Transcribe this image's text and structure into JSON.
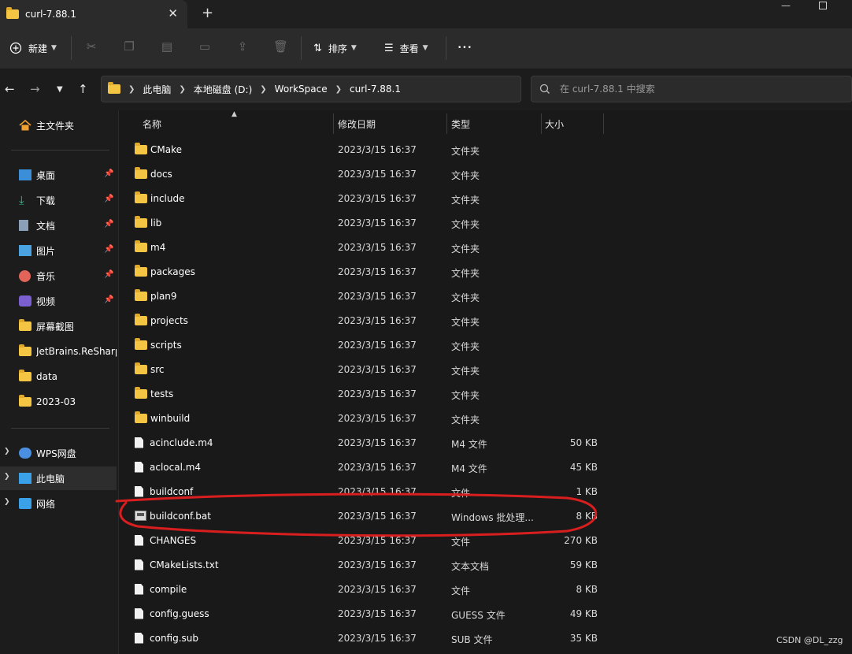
{
  "window": {
    "tab_title": "curl-7.88.1",
    "close_glyph": "✕",
    "new_tab_glyph": "+",
    "minimize_glyph": "—"
  },
  "toolbar": {
    "new_label": "新建",
    "sort_label": "排序",
    "view_label": "查看",
    "more_glyph": "•••"
  },
  "breadcrumb": [
    "此电脑",
    "本地磁盘 (D:)",
    "WorkSpace",
    "curl-7.88.1"
  ],
  "search": {
    "placeholder": "在 curl-7.88.1 中搜索"
  },
  "sidebar": {
    "home": "主文件夹",
    "quick": [
      {
        "label": "桌面",
        "icon": "desktop-icon",
        "color": "#3b8fd9"
      },
      {
        "label": "下载",
        "icon": "download-icon",
        "color": "#2fbf8f"
      },
      {
        "label": "文档",
        "icon": "document-icon",
        "color": "#8a9fb8"
      },
      {
        "label": "图片",
        "icon": "picture-icon",
        "color": "#4aa3e0"
      },
      {
        "label": "音乐",
        "icon": "music-icon",
        "color": "#e0645a"
      },
      {
        "label": "视频",
        "icon": "video-icon",
        "color": "#7b5fd0"
      }
    ],
    "folders": [
      "屏幕截图",
      "JetBrains.ReSharp",
      "data",
      "2023-03"
    ],
    "locations": [
      {
        "label": "WPS网盘",
        "icon": "cloud-icon"
      },
      {
        "label": "此电脑",
        "icon": "this-pc-icon"
      },
      {
        "label": "网络",
        "icon": "network-icon"
      }
    ]
  },
  "columns": {
    "name": "名称",
    "date": "修改日期",
    "type": "类型",
    "size": "大小"
  },
  "files": [
    {
      "name": "CMake",
      "date": "2023/3/15 16:37",
      "type": "文件夹",
      "size": "",
      "kind": "folder"
    },
    {
      "name": "docs",
      "date": "2023/3/15 16:37",
      "type": "文件夹",
      "size": "",
      "kind": "folder"
    },
    {
      "name": "include",
      "date": "2023/3/15 16:37",
      "type": "文件夹",
      "size": "",
      "kind": "folder"
    },
    {
      "name": "lib",
      "date": "2023/3/15 16:37",
      "type": "文件夹",
      "size": "",
      "kind": "folder"
    },
    {
      "name": "m4",
      "date": "2023/3/15 16:37",
      "type": "文件夹",
      "size": "",
      "kind": "folder"
    },
    {
      "name": "packages",
      "date": "2023/3/15 16:37",
      "type": "文件夹",
      "size": "",
      "kind": "folder"
    },
    {
      "name": "plan9",
      "date": "2023/3/15 16:37",
      "type": "文件夹",
      "size": "",
      "kind": "folder"
    },
    {
      "name": "projects",
      "date": "2023/3/15 16:37",
      "type": "文件夹",
      "size": "",
      "kind": "folder"
    },
    {
      "name": "scripts",
      "date": "2023/3/15 16:37",
      "type": "文件夹",
      "size": "",
      "kind": "folder"
    },
    {
      "name": "src",
      "date": "2023/3/15 16:37",
      "type": "文件夹",
      "size": "",
      "kind": "folder"
    },
    {
      "name": "tests",
      "date": "2023/3/15 16:37",
      "type": "文件夹",
      "size": "",
      "kind": "folder"
    },
    {
      "name": "winbuild",
      "date": "2023/3/15 16:37",
      "type": "文件夹",
      "size": "",
      "kind": "folder"
    },
    {
      "name": "acinclude.m4",
      "date": "2023/3/15 16:37",
      "type": "M4 文件",
      "size": "50 KB",
      "kind": "file"
    },
    {
      "name": "aclocal.m4",
      "date": "2023/3/15 16:37",
      "type": "M4 文件",
      "size": "45 KB",
      "kind": "file"
    },
    {
      "name": "buildconf",
      "date": "2023/3/15 16:37",
      "type": "文件",
      "size": "1 KB",
      "kind": "file"
    },
    {
      "name": "buildconf.bat",
      "date": "2023/3/15 16:37",
      "type": "Windows 批处理...",
      "size": "8 KB",
      "kind": "bat"
    },
    {
      "name": "CHANGES",
      "date": "2023/3/15 16:37",
      "type": "文件",
      "size": "270 KB",
      "kind": "file"
    },
    {
      "name": "CMakeLists.txt",
      "date": "2023/3/15 16:37",
      "type": "文本文档",
      "size": "59 KB",
      "kind": "text"
    },
    {
      "name": "compile",
      "date": "2023/3/15 16:37",
      "type": "文件",
      "size": "8 KB",
      "kind": "file"
    },
    {
      "name": "config.guess",
      "date": "2023/3/15 16:37",
      "type": "GUESS 文件",
      "size": "49 KB",
      "kind": "file"
    },
    {
      "name": "config.sub",
      "date": "2023/3/15 16:37",
      "type": "SUB 文件",
      "size": "35 KB",
      "kind": "file"
    }
  ],
  "watermark": "CSDN @DL_zzg",
  "colors": {
    "annotation": "#d81e1e",
    "folder": "#f4c542",
    "background": "#191919"
  }
}
